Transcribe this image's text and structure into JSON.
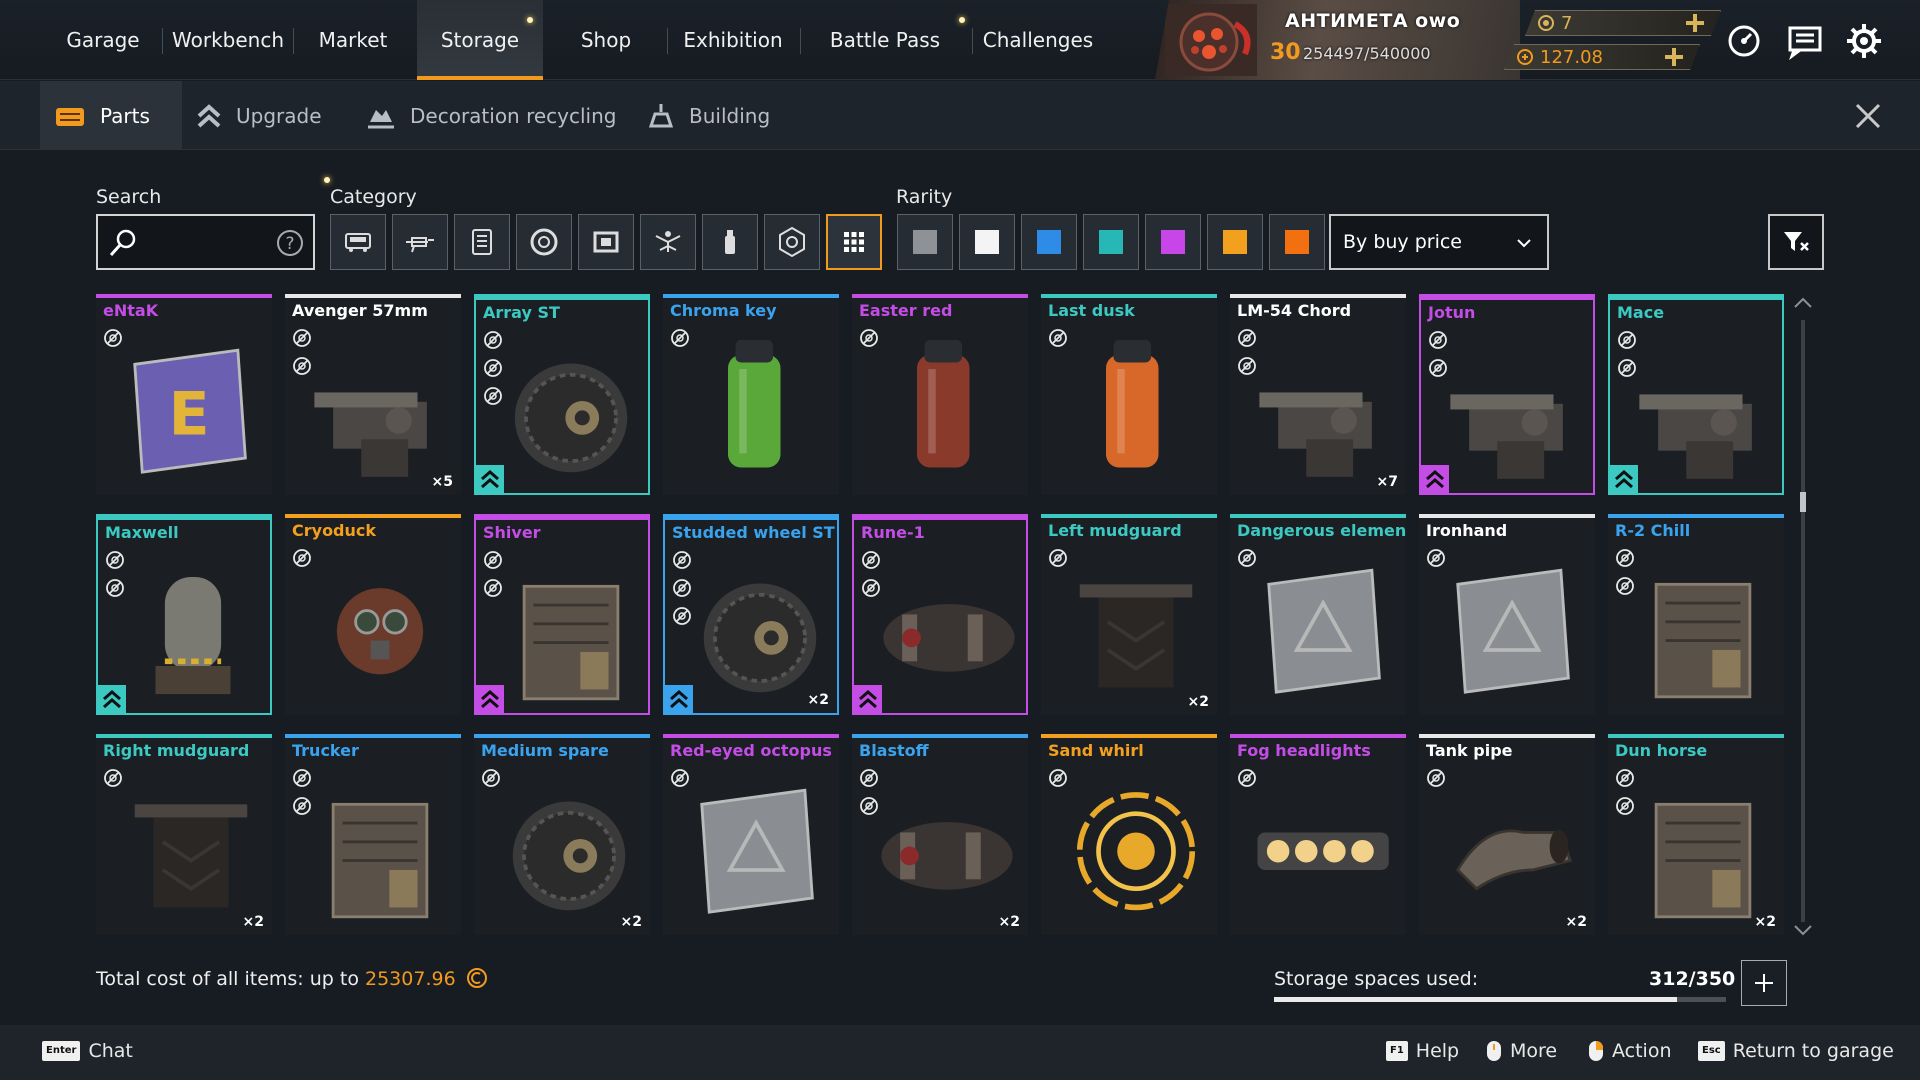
{
  "colors": {
    "accent": "#f29a1e",
    "common": "#e8e8e8",
    "rare": "#3aa3ee",
    "special": "#3bc9c2",
    "epic": "#c44de6",
    "legendary": "#f2a01e",
    "relic": "#f26a1e"
  },
  "nav": {
    "tabs": [
      {
        "label": "Garage"
      },
      {
        "label": "Workbench"
      },
      {
        "label": "Market"
      },
      {
        "label": "Storage"
      },
      {
        "label": "Shop"
      },
      {
        "label": "Exhibition"
      },
      {
        "label": "Battle Pass"
      },
      {
        "label": "Challenges"
      }
    ],
    "active": "Storage"
  },
  "player": {
    "name": "АНТИМЕТА owo",
    "level": "30",
    "xp": "254497/540000"
  },
  "currency": {
    "coins": "7",
    "credits": "127.08"
  },
  "subnav": {
    "tabs": [
      {
        "label": "Parts",
        "icon": "parts-icon"
      },
      {
        "label": "Upgrade",
        "icon": "upgrade-icon"
      },
      {
        "label": "Decoration recycling",
        "icon": "recycle-icon"
      },
      {
        "label": "Building",
        "icon": "building-icon"
      }
    ],
    "active": "Parts"
  },
  "filters": {
    "search_label": "Search",
    "search_value": "",
    "category_label": "Category",
    "categories": [
      "cabin-icon",
      "weapon-icon",
      "module-icon",
      "wheel-icon",
      "frame-icon",
      "decor-icon",
      "paint-icon",
      "hex-icon",
      "all-icon"
    ],
    "category_selected": "all-icon",
    "rarity_label": "Rarity",
    "rarities": [
      "#8e9196",
      "#f4f4f4",
      "#2e8ce6",
      "#27b7b5",
      "#c845e8",
      "#f2a01e",
      "#f2700f"
    ],
    "sort": "By buy price"
  },
  "items": [
    {
      "name": "eNtaK",
      "rarity": "epic",
      "icons": 1,
      "count": "",
      "upgrade": false
    },
    {
      "name": "Avenger 57mm",
      "rarity": "common",
      "icons": 2,
      "count": "×5",
      "upgrade": false
    },
    {
      "name": "Array ST",
      "rarity": "special",
      "icons": 3,
      "count": "",
      "upgrade": true,
      "framed": true
    },
    {
      "name": "Chroma key",
      "rarity": "rare",
      "icons": 1,
      "count": "",
      "upgrade": false
    },
    {
      "name": "Easter red",
      "rarity": "epic",
      "icons": 1,
      "count": "",
      "upgrade": false
    },
    {
      "name": "Last dusk",
      "rarity": "special",
      "icons": 1,
      "count": "",
      "upgrade": false
    },
    {
      "name": "LM-54 Chord",
      "rarity": "common",
      "icons": 2,
      "count": "×7",
      "upgrade": false
    },
    {
      "name": "Jotun",
      "rarity": "epic",
      "icons": 2,
      "count": "",
      "upgrade": true,
      "framed": true
    },
    {
      "name": "Mace",
      "rarity": "special",
      "icons": 2,
      "count": "",
      "upgrade": true,
      "framed": true
    },
    {
      "name": "Maxwell",
      "rarity": "special",
      "icons": 2,
      "count": "",
      "upgrade": true,
      "framed": true
    },
    {
      "name": "Cryoduck",
      "rarity": "legendary",
      "icons": 1,
      "count": "",
      "upgrade": false
    },
    {
      "name": "Shiver",
      "rarity": "epic",
      "icons": 2,
      "count": "",
      "upgrade": true,
      "framed": true
    },
    {
      "name": "Studded wheel ST",
      "rarity": "rare",
      "icons": 3,
      "count": "×2",
      "upgrade": true,
      "framed": true
    },
    {
      "name": "Rune-1",
      "rarity": "epic",
      "icons": 2,
      "count": "",
      "upgrade": true,
      "framed": true
    },
    {
      "name": "Left mudguard",
      "rarity": "special",
      "icons": 1,
      "count": "×2",
      "upgrade": false
    },
    {
      "name": "Dangerous element",
      "rarity": "special",
      "icons": 1,
      "count": "",
      "upgrade": false
    },
    {
      "name": "Ironhand",
      "rarity": "common",
      "icons": 1,
      "count": "",
      "upgrade": false
    },
    {
      "name": "R-2 Chill",
      "rarity": "rare",
      "icons": 2,
      "count": "",
      "upgrade": false
    },
    {
      "name": "Right mudguard",
      "rarity": "special",
      "icons": 1,
      "count": "×2",
      "upgrade": false
    },
    {
      "name": "Trucker",
      "rarity": "rare",
      "icons": 2,
      "count": "",
      "upgrade": false
    },
    {
      "name": "Medium spare",
      "rarity": "rare",
      "icons": 1,
      "count": "×2",
      "upgrade": false
    },
    {
      "name": "Red-eyed octopus",
      "rarity": "epic",
      "icons": 1,
      "count": "",
      "upgrade": false
    },
    {
      "name": "Blastoff",
      "rarity": "rare",
      "icons": 2,
      "count": "×2",
      "upgrade": false
    },
    {
      "name": "Sand whirl",
      "rarity": "legendary",
      "icons": 1,
      "count": "",
      "upgrade": false
    },
    {
      "name": "Fog headlights",
      "rarity": "epic",
      "icons": 1,
      "count": "",
      "upgrade": false
    },
    {
      "name": "Tank pipe",
      "rarity": "common",
      "icons": 1,
      "count": "×2",
      "upgrade": false
    },
    {
      "name": "Dun horse",
      "rarity": "special",
      "icons": 2,
      "count": "×2",
      "upgrade": false
    }
  ],
  "footer": {
    "total_label": "Total cost of all items: up to",
    "total_value": "25307.96",
    "storage_label": "Storage spaces used:",
    "storage_value": "312/350",
    "storage_fraction": 0.8914
  },
  "hints": [
    {
      "key": "Enter",
      "label": "Chat"
    },
    {
      "key": "F1",
      "label": "Help"
    },
    {
      "key": "mouse-scroll-icon",
      "label": "More"
    },
    {
      "key": "mouse-right-icon",
      "label": "Action"
    },
    {
      "key": "Esc",
      "label": "Return to garage"
    }
  ]
}
